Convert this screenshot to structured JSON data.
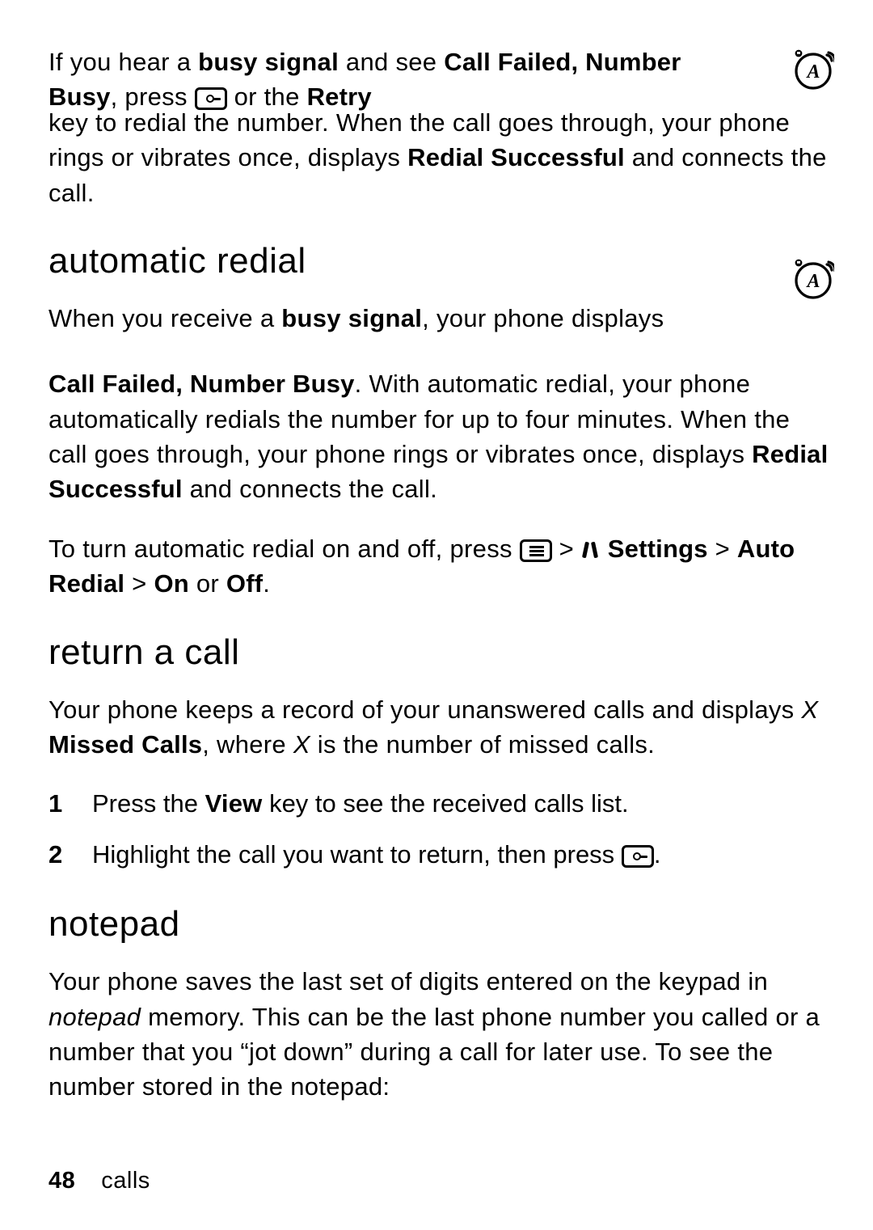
{
  "intro": {
    "t1": "If you hear a ",
    "t2_bold": "busy signal",
    "t3": " and see ",
    "t4_cond": "Call Failed, Number Busy",
    "t5": ", press ",
    "t6": " or the ",
    "t7_cond": "Retry",
    "t8": " key to redial the number. When the call goes through, your phone rings or vibrates once, displays ",
    "t9_cond": "Redial Successful",
    "t10": " and connects the call."
  },
  "sec1_heading": "automatic redial",
  "auto1": {
    "a1": "When you receive a ",
    "a2_bold": "busy signal",
    "a3": ", your phone displays ",
    "a4_cond": "Call Failed, Number Busy",
    "a5": ". With automatic redial, your phone automatically redials the number for up to four minutes. When the call goes through, your phone rings or vibrates once, displays ",
    "a6_cond": "Redial Successful",
    "a7": " and connects the call."
  },
  "auto2": {
    "b1": "To turn automatic redial on and off, press ",
    "b2": " > ",
    "b3_cond": " Settings",
    "b4": " > ",
    "b5_cond": "Auto Redial",
    "b6": " > ",
    "b7_cond": "On",
    "b8": " or ",
    "b9_cond": "Off",
    "b10": "."
  },
  "sec2_heading": "return a call",
  "returnp": {
    "r1": "Your phone keeps a record of your unanswered calls and displays ",
    "r2_ital": "X",
    "r3_space": " ",
    "r4_cond": "Missed Calls",
    "r5": ", where ",
    "r6_ital": "X",
    "r7": " is the number of missed calls."
  },
  "steps": {
    "s1a": "Press the ",
    "s1b_cond": "View",
    "s1c": " key to see the received calls list.",
    "s2a": "Highlight the call you want to return, then press ",
    "s2b": "."
  },
  "sec3_heading": "notepad",
  "notepadp": {
    "n1": "Your phone saves the last set of digits entered on the keypad in ",
    "n2_ital": "notepad",
    "n3": " memory. This can be the last phone number you called or a number that you “jot down” during a call for later use. To see the number stored in the notepad:"
  },
  "footer": {
    "page": "48",
    "section": "calls"
  }
}
